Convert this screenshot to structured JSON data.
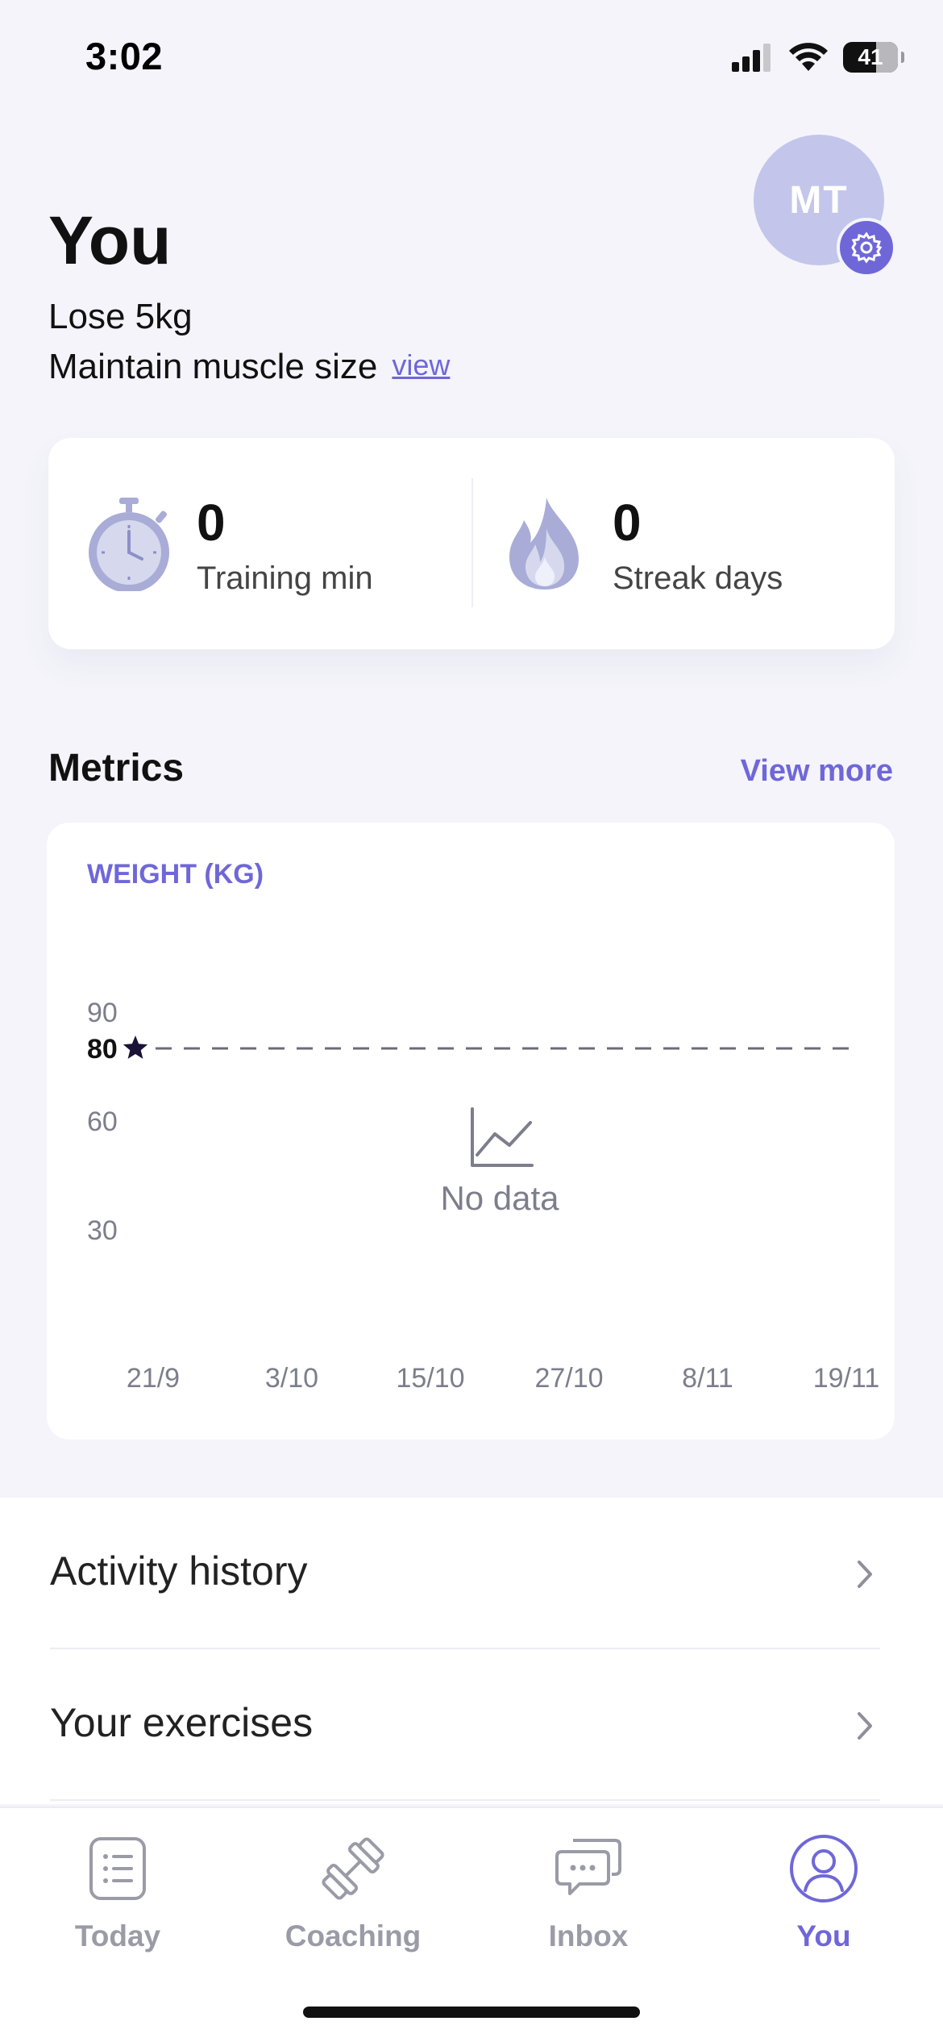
{
  "status_bar": {
    "time": "3:02",
    "battery": "41"
  },
  "header": {
    "title": "You",
    "goals": [
      "Lose 5kg",
      "Maintain muscle size"
    ],
    "view_link": "view",
    "avatar_initials": "MT"
  },
  "stats": {
    "training": {
      "value": "0",
      "label": "Training min"
    },
    "streak": {
      "value": "0",
      "label": "Streak days"
    }
  },
  "metrics": {
    "title": "Metrics",
    "view_more": "View more"
  },
  "chart_data": {
    "type": "line",
    "title": "WEIGHT (KG)",
    "y_ticks": [
      "90",
      "60",
      "30"
    ],
    "ylim": [
      0,
      90
    ],
    "target": {
      "value": 80,
      "label": "80"
    },
    "x_ticks": [
      "21/9",
      "3/10",
      "15/10",
      "27/10",
      "8/11",
      "19/11"
    ],
    "series": [],
    "empty_message": "No data",
    "grid": false
  },
  "list": {
    "items": [
      {
        "label": "Activity history"
      },
      {
        "label": "Your exercises"
      }
    ]
  },
  "tabs": [
    {
      "label": "Today",
      "icon": "list-icon",
      "active": false
    },
    {
      "label": "Coaching",
      "icon": "dumbbell-icon",
      "active": false
    },
    {
      "label": "Inbox",
      "icon": "chat-bubbles-icon",
      "active": false
    },
    {
      "label": "You",
      "icon": "user-icon",
      "active": true
    }
  ],
  "colors": {
    "accent": "#6f67d8",
    "background": "#f4f4fa",
    "avatar_bg": "#c3c6ea",
    "icon_muted": "#a9acd6"
  }
}
